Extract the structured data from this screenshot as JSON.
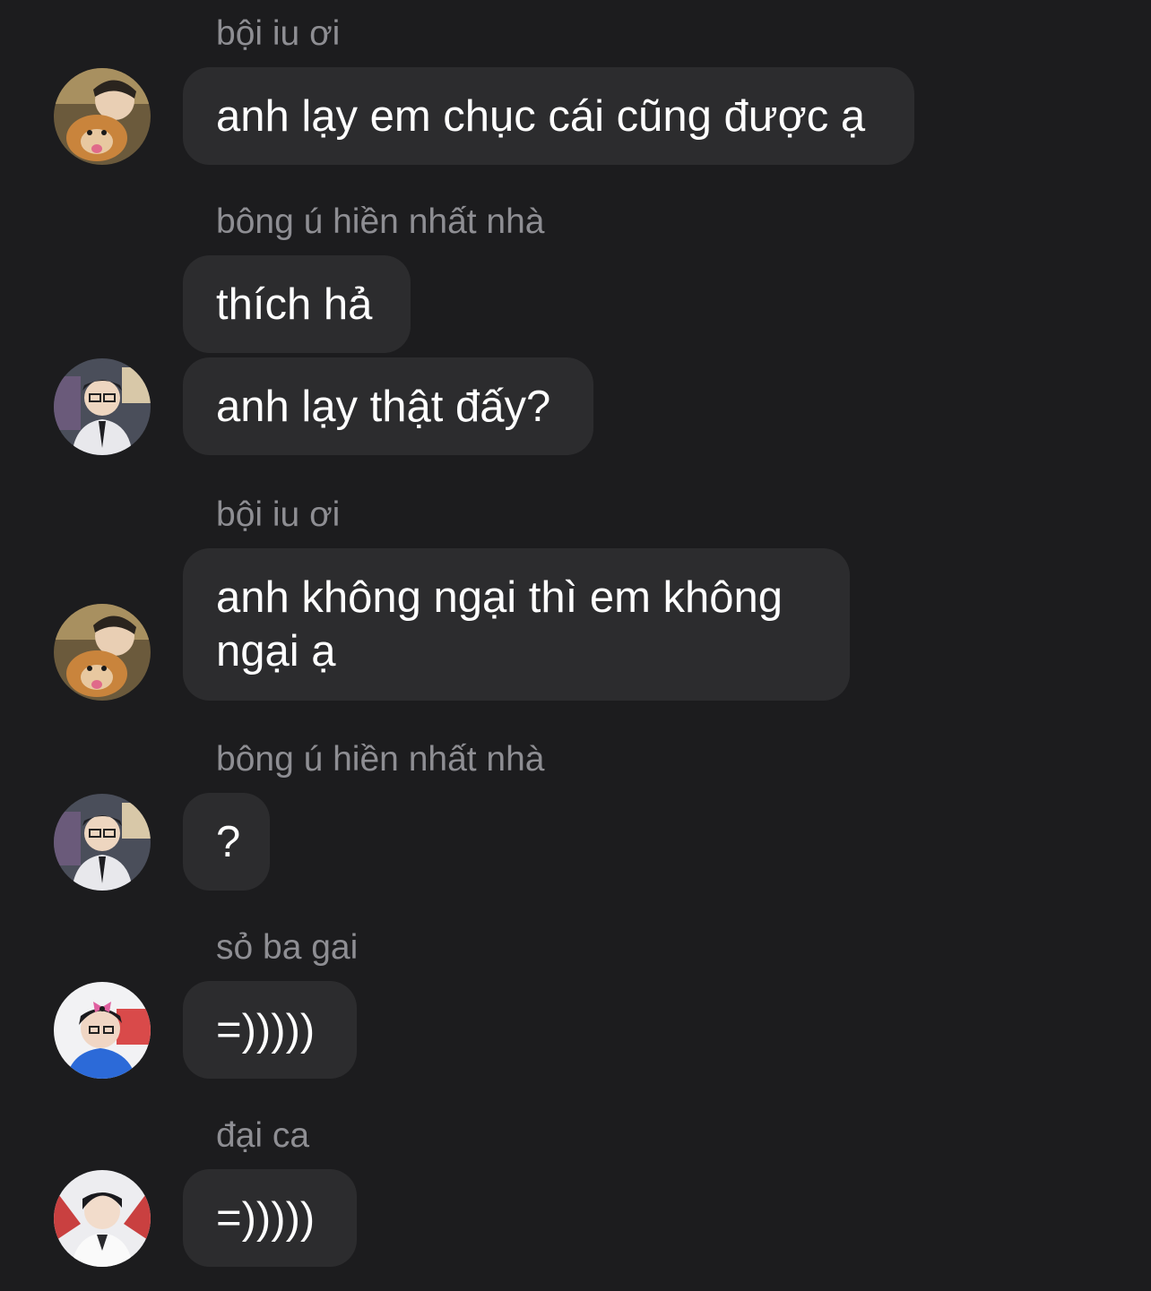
{
  "messages": [
    {
      "sender": "bội iu ơi",
      "text": "anh lạy em chục cái cũng được ạ",
      "avatar": "avatar-user-with-dog"
    },
    {
      "sender": "bông ú hiền nhất nhà",
      "text": "thích hả"
    },
    {
      "text": "anh lạy thật đấy?",
      "avatar": "avatar-user-glasses"
    },
    {
      "sender": "bội iu ơi",
      "text": "anh không ngại thì em không ngại ạ",
      "avatar": "avatar-user-with-dog"
    },
    {
      "sender": "bông ú hiền nhất nhà",
      "text": "?",
      "avatar": "avatar-user-glasses"
    },
    {
      "sender": "sỏ ba gai",
      "text": "=)))))",
      "avatar": "avatar-user-bow"
    },
    {
      "sender": "đại ca",
      "text": "=)))))",
      "avatar": "avatar-user-white"
    }
  ]
}
